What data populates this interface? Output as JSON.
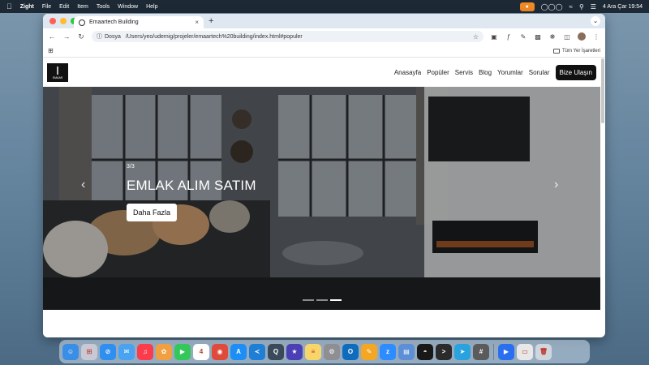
{
  "menubar": {
    "app_name": "Zight",
    "menus": [
      "File",
      "Edit",
      "Item",
      "Tools",
      "Window",
      "Help"
    ],
    "datetime": "4 Ara Çar  19:54"
  },
  "browser": {
    "tab_title": "Emaartech Building",
    "url_protocol_label": "Dosya",
    "url": "/Users/yeo/udemig/projeler/emaartech%20building/index.html#populer",
    "bookmarks_label": "Tüm Yer İşaretleri"
  },
  "site": {
    "logo_text": "EMAAR",
    "nav": [
      "Anasayfa",
      "Popüler",
      "Servis",
      "Blog",
      "Yorumlar",
      "Sorular"
    ],
    "cta_label": "Bize Ulaşın"
  },
  "hero": {
    "slide_counter": "3/3",
    "title": "EMLAK ALIM SATIM",
    "button_label": "Daha Fazla",
    "slides_total": 3,
    "active_slide": 3
  },
  "dock": {
    "apps": [
      {
        "name": "finder-icon",
        "color": "#3a8ee6",
        "glyph": "☺"
      },
      {
        "name": "launchpad-icon",
        "color": "#c9c9d6",
        "glyph": "⊞"
      },
      {
        "name": "safari-icon",
        "color": "#2f8ff0",
        "glyph": "⊘"
      },
      {
        "name": "mail-icon",
        "color": "#4aa3f0",
        "glyph": "✉"
      },
      {
        "name": "music-icon",
        "color": "#fa3c4c",
        "glyph": "♫"
      },
      {
        "name": "photos-icon",
        "color": "#f0a040",
        "glyph": "✿"
      },
      {
        "name": "facetime-icon",
        "color": "#34c759",
        "glyph": "▶"
      },
      {
        "name": "calendar-icon",
        "color": "#ffffff",
        "glyph": "4"
      },
      {
        "name": "chrome-icon",
        "color": "#e04a3a",
        "glyph": "◉"
      },
      {
        "name": "appstore-icon",
        "color": "#1c8ef5",
        "glyph": "A"
      },
      {
        "name": "vscode-icon",
        "color": "#1f7ed6",
        "glyph": "≺"
      },
      {
        "name": "quicktime-icon",
        "color": "#3a4a5a",
        "glyph": "Q"
      },
      {
        "name": "superstar-icon",
        "color": "#4b3fb5",
        "glyph": "★"
      },
      {
        "name": "notes-icon",
        "color": "#f7d568",
        "glyph": "≡"
      },
      {
        "name": "settings-icon",
        "color": "#8e8e93",
        "glyph": "⚙"
      },
      {
        "name": "outlook-icon",
        "color": "#0f6cbd",
        "glyph": "O"
      },
      {
        "name": "pencil-icon",
        "color": "#f5a623",
        "glyph": "✎"
      },
      {
        "name": "zoom-icon",
        "color": "#2d8cff",
        "glyph": "z"
      },
      {
        "name": "preview-icon",
        "color": "#5c8fd6",
        "glyph": "▤"
      },
      {
        "name": "github-icon",
        "color": "#181818",
        "glyph": "◓"
      },
      {
        "name": "terminal-icon",
        "color": "#2b2b2b",
        "glyph": ">"
      },
      {
        "name": "telegram-icon",
        "color": "#2aa2de",
        "glyph": "➤"
      },
      {
        "name": "calculator-icon",
        "color": "#5b5b5b",
        "glyph": "#"
      },
      {
        "name": "zight-icon",
        "color": "#2a6ff0",
        "glyph": "▶"
      },
      {
        "name": "downloads-icon",
        "color": "#e8e8e8",
        "glyph": "▭"
      },
      {
        "name": "trash-icon",
        "color": "#cfd6de",
        "glyph": "🗑"
      }
    ]
  }
}
